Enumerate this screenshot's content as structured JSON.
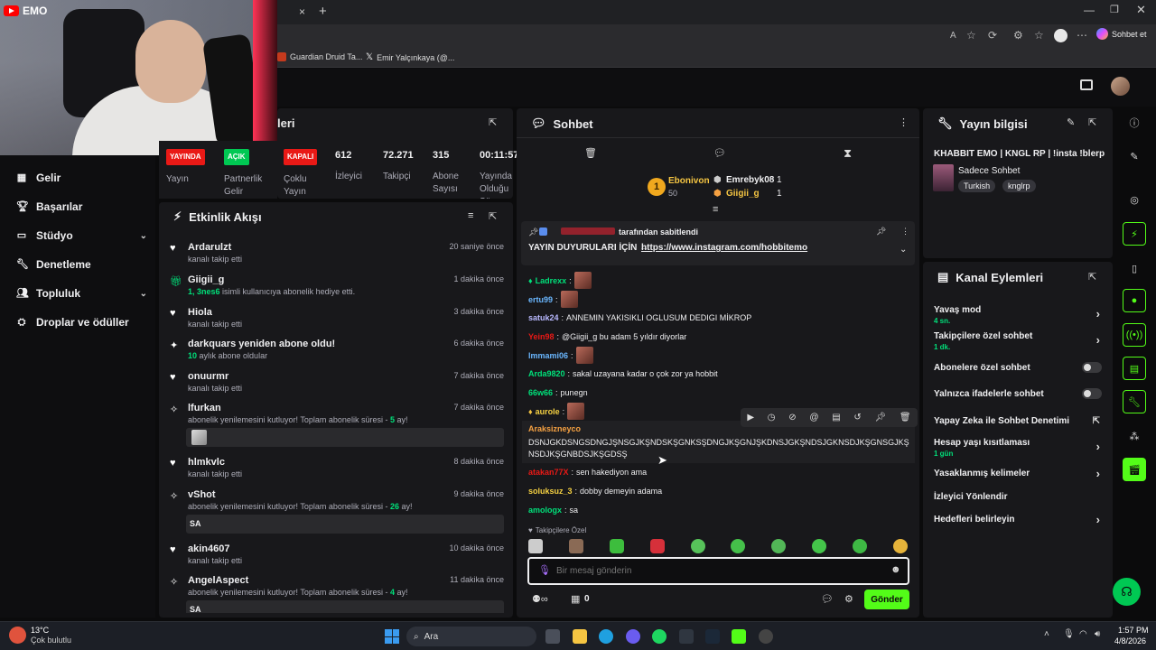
{
  "webcam": {
    "label": "EMO"
  },
  "browser": {
    "new_tab_glyph": "+",
    "close_tab_glyph": "×",
    "chat_button": "Sohbet et",
    "bookmarks": [
      "Guardian Druid Ta...",
      "Emir Yalçınkaya (@..."
    ]
  },
  "sidebar": {
    "items": [
      {
        "label": "Gelir",
        "icon": "revenue-icon"
      },
      {
        "label": "Başarılar",
        "icon": "trophy-icon"
      },
      {
        "label": "Stüdyo",
        "icon": "studio-icon"
      },
      {
        "label": "Denetleme",
        "icon": "wrench-icon"
      },
      {
        "label": "Topluluk",
        "icon": "community-icon"
      },
      {
        "label": "Droplar ve ödüller",
        "icon": "gift-icon"
      }
    ]
  },
  "stats_panel": {
    "title_fragment": "leri",
    "items": [
      {
        "pill": "YAYINDA",
        "label": "Yayın",
        "pill_color": "#e91916"
      },
      {
        "pill": "AÇIK",
        "label": "Partnerlik Gelir",
        "pill_color": "#00c853"
      },
      {
        "pill": "KAPALI",
        "label": "Çoklu Yayın",
        "pill_color": "#e91916"
      },
      {
        "value": "612",
        "label": "İzleyici"
      },
      {
        "value": "72.271",
        "label": "Takipçi"
      },
      {
        "value": "315",
        "label": "Abone Sayısı"
      },
      {
        "value": "00:11:57",
        "label": "Yayında Olduğu Süre"
      }
    ]
  },
  "activity": {
    "title": "Etkinlik Akışı",
    "items": [
      {
        "name": "Ardarulzt",
        "sub": "kanalı takip etti",
        "time": "20 saniye önce",
        "icon": "heart-icon"
      },
      {
        "name": "Giigii_g",
        "sub_hl": "1, 3nes6",
        "sub": " isimli kullanıcıya abonelik hediye etti.",
        "time": "1 dakika önce",
        "icon": "gift-icon"
      },
      {
        "name": "Hiola",
        "sub": "kanalı takip etti",
        "time": "3 dakika önce",
        "icon": "heart-icon"
      },
      {
        "name": "darkquars yeniden abone oldu!",
        "sub_hl": "10",
        "sub": " aylık abone oldular",
        "time": "6 dakika önce",
        "icon": "star-icon"
      },
      {
        "name": "onuurmr",
        "sub": "kanalı takip etti",
        "time": "7 dakika önce",
        "icon": "heart-icon"
      },
      {
        "name": "lfurkan",
        "sub": "abonelik yenilemesini kutluyor! Toplam abonelik süresi - ",
        "sub_hl": "5",
        "sub_end": " ay!",
        "time": "7 dakika önce",
        "icon": "resub-icon"
      },
      {
        "name": "hlmkvlc",
        "sub": "kanalı takip etti",
        "time": "8 dakika önce",
        "icon": "heart-icon"
      },
      {
        "name": "vShot",
        "sub": "abonelik yenilemesini kutluyor! Toplam abonelik süresi - ",
        "sub_hl": "26",
        "sub_end": " ay!",
        "time": "9 dakika önce",
        "icon": "resub-icon",
        "msg": "SA"
      },
      {
        "name": "akin4607",
        "sub": "kanalı takip etti",
        "time": "10 dakika önce",
        "icon": "heart-icon"
      },
      {
        "name": "AngelAspect",
        "sub": "abonelik yenilemesini kutluyor! Toplam abonelik süresi - ",
        "sub_hl": "4",
        "sub_end": " ay!",
        "time": "11 dakika önce",
        "icon": "resub-icon",
        "msg": "SA"
      }
    ]
  },
  "chat": {
    "title": "Sohbet",
    "leader": {
      "rank": "1",
      "name": "Ebonivon",
      "points": "50"
    },
    "leaders_side": [
      {
        "name": "Emrebyk08",
        "n": "1"
      },
      {
        "name": "Giigii_g",
        "n": "1"
      }
    ],
    "pinned": {
      "by_suffix": "tarafından sabitlendi",
      "text": "YAYIN DUYURULARI İÇİN →",
      "link": "https://www.instagram.com/hobbitemo"
    },
    "messages": [
      {
        "user": "Ladrexx",
        "color": "#00e07a",
        "text": "",
        "emote": true
      },
      {
        "user": "ertu99",
        "color": "#6ab7ff",
        "text": "",
        "emote": true
      },
      {
        "user": "satuk24",
        "color": "#b9b9ff",
        "text": "ANNEMIN YAKISIKLI OGLUSUM DEDIGI MİKROP"
      },
      {
        "user": "Yein98",
        "color": "#e91916",
        "text": "@Giigii_g bu adam 5 yıldır diyorlar"
      },
      {
        "user": "lmmami06",
        "color": "#6ab7ff",
        "text": "",
        "emote": true
      },
      {
        "user": "Arda9820",
        "color": "#00e07a",
        "text": "sakal uzayana kadar o çok zor ya hobbit"
      },
      {
        "user": "66w66",
        "color": "#00e07a",
        "text": "punegn"
      },
      {
        "user": "aurole",
        "color": "#f5d142",
        "text": "",
        "emote": true
      },
      {
        "user": "Araksizneyco",
        "color": "#f5a142",
        "text": "DSNJGKDSNGSDNGJŞNSGJKŞNDSKŞGNKSŞDNGJKŞGNJŞKDNSJGKŞNDSJGKNSDJKŞGNSGJKŞNSDJKŞGNBDSJKŞGDSŞ"
      },
      {
        "user": "atakan77X",
        "color": "#e91916",
        "text": "sen hakediyon ama"
      },
      {
        "user": "soluksuz_3",
        "color": "#f5d142",
        "text": "dobby demeyin adama"
      },
      {
        "user": "amologx",
        "color": "#00e07a",
        "text": "sa"
      }
    ],
    "follower_only": "Takipçilere Özel",
    "input_placeholder": "Bir mesaj gönderin",
    "points": "0",
    "send": "Gönder"
  },
  "stream_info": {
    "title": "Yayın bilgisi",
    "stream_title": "KHABBIT EMO | KNGL RP | !insta !blerp",
    "category": "Sadece Sohbet",
    "tags": [
      "Turkish",
      "knglrp"
    ]
  },
  "channel_actions": {
    "title": "Kanal Eylemleri",
    "items": [
      {
        "label": "Yavaş mod",
        "sub": "4 sn.",
        "kind": "arrow"
      },
      {
        "label": "Takipçilere özel sohbet",
        "sub": "1 dk.",
        "kind": "arrow"
      },
      {
        "label": "Abonelere özel sohbet",
        "kind": "toggle"
      },
      {
        "label": "Yalnızca ifadelerle sohbet",
        "kind": "toggle"
      },
      {
        "label": "Yapay Zeka ile Sohbet Denetimi",
        "kind": "external"
      },
      {
        "label": "Hesap yaşı kısıtlaması",
        "sub": "1 gün",
        "kind": "arrow"
      },
      {
        "label": "Yasaklanmış kelimeler",
        "kind": "arrow"
      },
      {
        "label": "İzleyici Yönlendir",
        "kind": "none"
      },
      {
        "label": "Hedefleri belirleyin",
        "kind": "arrow"
      }
    ]
  },
  "taskbar": {
    "weather_temp": "13°C",
    "weather_desc": "Çok bulutlu",
    "search": "Ara",
    "time": "1:57 PM",
    "date": "4/8/2026"
  },
  "colors": {
    "accent": "#53fc18",
    "live": "#e91916",
    "panel": "#18181b",
    "bg": "#0b0b0c"
  }
}
